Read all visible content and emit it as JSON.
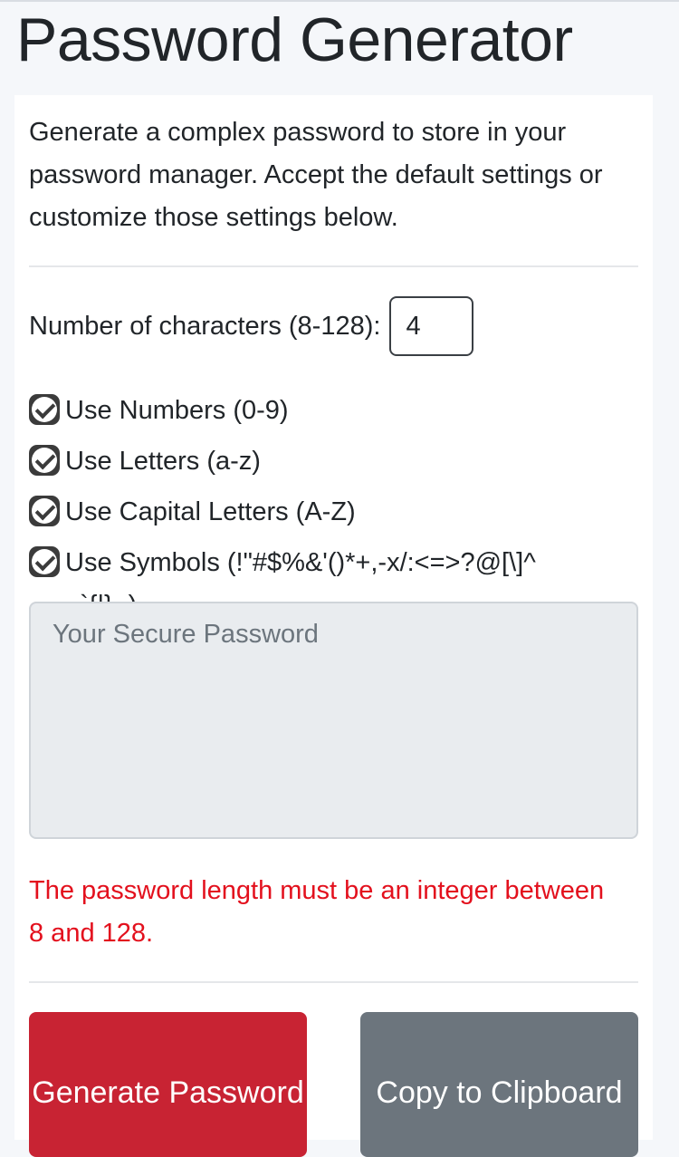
{
  "header": {
    "title": "Password Generator"
  },
  "card": {
    "intro": "Generate a complex password to store in your password manager. Accept the default settings or customize those settings below.",
    "length": {
      "label": "Number of characters (8-128):",
      "value": "4"
    },
    "options": [
      {
        "label": "Use Numbers (0-9)",
        "checked": true
      },
      {
        "label": "Use Letters (a-z)",
        "checked": true
      },
      {
        "label": "Use Capital Letters (A-Z)",
        "checked": true
      },
      {
        "label": "Use Symbols (!\"#$%&'()*+,-x/:<=>?@[\\]^_`{|}~)",
        "checked": true
      }
    ],
    "password": {
      "placeholder": "Your Secure Password",
      "value": ""
    },
    "error": "The password length must be an integer between 8 and 128.",
    "buttons": {
      "generate": "Generate Password",
      "copy": "Copy to Clipboard"
    }
  },
  "colors": {
    "danger": "#c82333",
    "secondary": "#6c757d",
    "error_text": "#e3101d"
  }
}
